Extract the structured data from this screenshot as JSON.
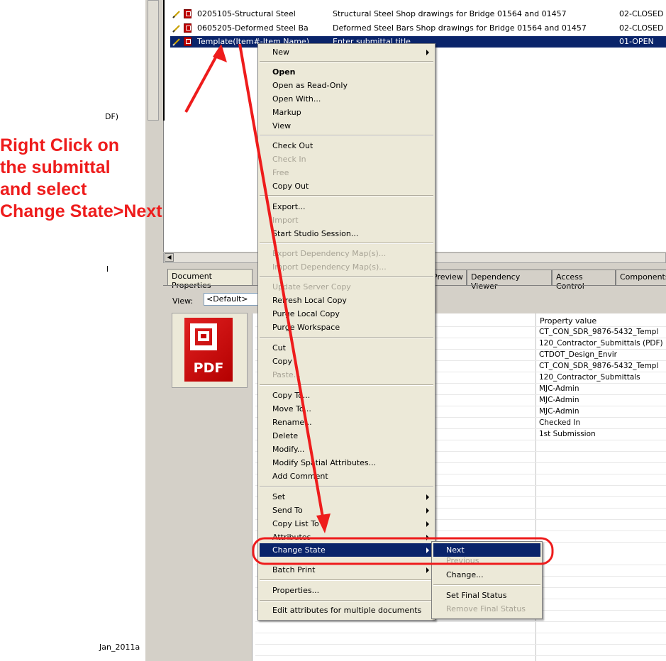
{
  "documents": [
    {
      "name": "0205105-Structural Steel",
      "title": "Structural Steel Shop drawings for Bridge 01564 and 01457",
      "state": "02-CLOSED"
    },
    {
      "name": "0605205-Deformed Steel Ba",
      "title": "Deformed Steel Bars Shop drawings for Bridge 01564 and 01457",
      "state": "02-CLOSED"
    },
    {
      "name": "Template(Item#-Item Name)",
      "title": "Enter submittal title",
      "state": "01-OPEN"
    }
  ],
  "left_panel": {
    "frag1": "DF)",
    "frag2": "l",
    "frag3": "Jan_2011a"
  },
  "instruction": {
    "line1": "Right Click on",
    "line2": "the submittal",
    "line3": "and select",
    "line4": "Change State>Next"
  },
  "tabs": {
    "document_properties": "Document Properties",
    "preview": "Preview",
    "dependency_viewer": "Dependency Viewer",
    "access_control": "Access Control",
    "components": "Components"
  },
  "view": {
    "label": "View:",
    "value": "<Default>"
  },
  "pdf_label": "PDF",
  "property_table": {
    "header": "Property value",
    "values": [
      "CT_CON_SDR_9876-5432_Templ",
      "120_Contractor_Submittals (PDF)",
      "CTDOT_Design_Envir",
      "CT_CON_SDR_9876-5432_Templ",
      "120_Contractor_Submittals",
      "MJC-Admin",
      "MJC-Admin",
      "MJC-Admin",
      "Checked In",
      "1st Submission"
    ]
  },
  "context_menu": {
    "new": "New",
    "open": "Open",
    "open_read_only": "Open as Read-Only",
    "open_with": "Open With...",
    "markup": "Markup",
    "view": "View",
    "check_out": "Check Out",
    "check_in": "Check In",
    "free": "Free",
    "copy_out": "Copy Out",
    "export": "Export...",
    "import": "Import",
    "start_studio": "Start Studio Session...",
    "export_dep": "Export Dependency Map(s)...",
    "import_dep": "Import Dependency Map(s)...",
    "update_server": "Update Server Copy",
    "refresh_local": "Refresh Local Copy",
    "purge_local": "Purge Local Copy",
    "purge_workspace": "Purge Workspace",
    "cut": "Cut",
    "copy": "Copy",
    "paste": "Paste...",
    "copy_to": "Copy To...",
    "move_to": "Move To...",
    "rename": "Rename...",
    "delete": "Delete",
    "modify": "Modify...",
    "modify_spatial": "Modify Spatial Attributes...",
    "add_comment": "Add Comment",
    "set": "Set",
    "send_to": "Send To",
    "copy_list_to": "Copy List To",
    "attributes": "Attributes",
    "change_state": "Change State",
    "batch_print": "Batch Print",
    "properties": "Properties...",
    "edit_attributes": "Edit attributes for multiple documents"
  },
  "submenu": {
    "next": "Next",
    "previous": "Previous",
    "change": "Change...",
    "set_final": "Set Final Status",
    "remove_final": "Remove Final Status"
  },
  "colors": {
    "highlight": "#0a246a",
    "annotation": "#ee1c1c",
    "menu_bg": "#ece9d8"
  }
}
